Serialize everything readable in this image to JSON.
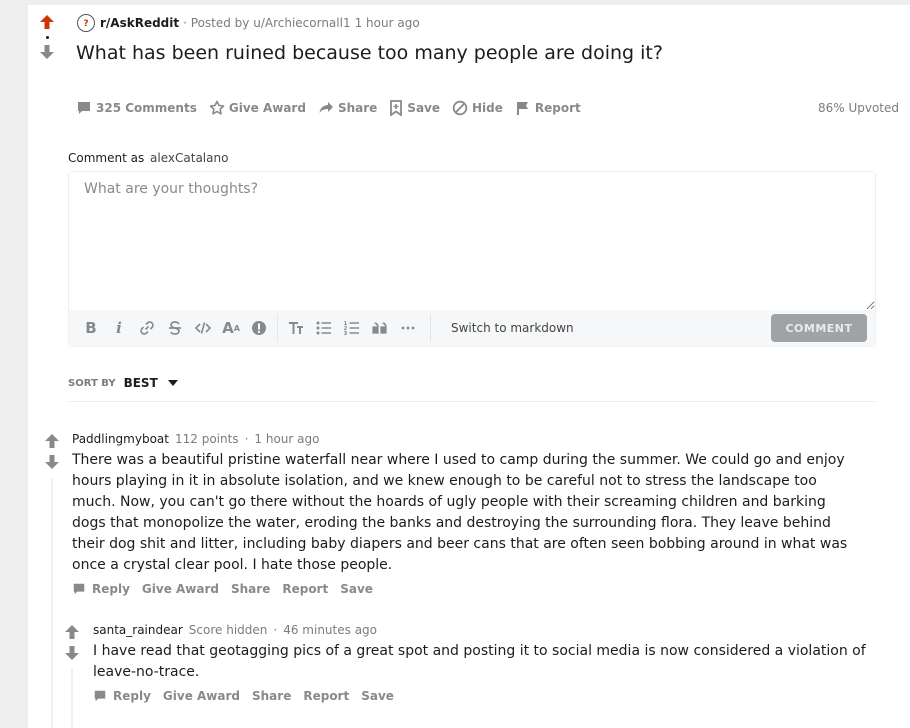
{
  "post": {
    "subreddit": "r/AskReddit",
    "posted_by": "· Posted by u/Archiecornall1",
    "time": "1 hour ago",
    "title": "What has been ruined because too many people are doing it?",
    "actions": {
      "comments": "325 Comments",
      "give_award": "Give Award",
      "share": "Share",
      "save": "Save",
      "hide": "Hide",
      "report": "Report"
    },
    "upvoted": "86% Upvoted"
  },
  "comment_box": {
    "label": "Comment as",
    "username": "alexCatalano",
    "placeholder": "What are your thoughts?",
    "switch_markdown": "Switch to markdown",
    "submit": "COMMENT"
  },
  "sort": {
    "label": "SORT BY",
    "value": "BEST"
  },
  "comments": [
    {
      "author": "Paddlingmyboat",
      "score": "112 points",
      "sep": "·",
      "time": "1 hour ago",
      "body": "There was a beautiful pristine waterfall near where I used to camp during the summer. We could go and enjoy hours playing in it in absolute isolation, and we knew enough to be careful not to stress the landscape too much. Now, you can't go there without the hoards of ugly people with their screaming children and barking dogs that monopolize the water, eroding the banks and destroying the surrounding flora. They leave behind their dog shit and litter, including baby diapers and beer cans that are often seen bobbing around in what was once a crystal clear pool. I hate those people.",
      "actions": {
        "reply": "Reply",
        "give_award": "Give Award",
        "share": "Share",
        "report": "Report",
        "save": "Save"
      }
    },
    {
      "author": "santa_raindear",
      "score": "Score hidden",
      "sep": "·",
      "time": "46 minutes ago",
      "body": "I have read that geotagging pics of a great spot and posting it to social media is now considered a violation of leave-no-trace.",
      "actions": {
        "reply": "Reply",
        "give_award": "Give Award",
        "share": "Share",
        "report": "Report",
        "save": "Save"
      }
    }
  ],
  "colors": {
    "upvote_active": "#cc3700",
    "arrow_gray": "#878a8c",
    "button_disabled": "#a0a3a5"
  }
}
